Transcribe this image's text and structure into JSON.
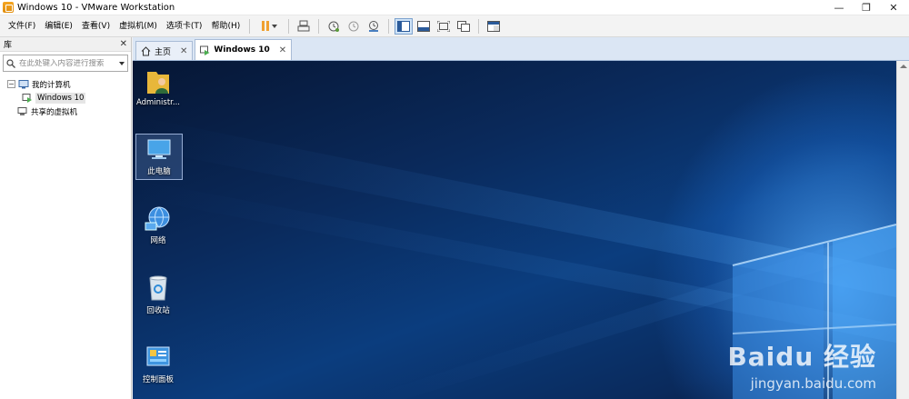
{
  "window": {
    "title": "Windows 10 - VMware Workstation",
    "minimize_glyph": "—",
    "restore_glyph": "❐",
    "close_glyph": "✕"
  },
  "menubar": {
    "items": [
      "文件(F)",
      "编辑(E)",
      "查看(V)",
      "虚拟机(M)",
      "选项卡(T)",
      "帮助(H)"
    ]
  },
  "toolbar": {
    "icons": [
      "pause-icon",
      "send-ctrl-alt-del-icon",
      "snapshot-icon",
      "revert-snapshot-icon",
      "snapshot-manager-icon",
      "show-library-icon",
      "thumbnail-bar-icon",
      "full-screen-icon",
      "unity-icon",
      "console-view-icon"
    ]
  },
  "library": {
    "title": "库",
    "close": "✕",
    "search_placeholder": "在此处键入内容进行搜索",
    "tree": {
      "my_computer": "我的计算机",
      "vm_windows10": "Windows 10",
      "shared_vms": "共享的虚拟机",
      "toggle": "−"
    }
  },
  "tabs": [
    {
      "label": "主页",
      "close": "✕"
    },
    {
      "label": "Windows 10",
      "close": "✕"
    }
  ],
  "desktop": {
    "icons": [
      {
        "label": "Administr..."
      },
      {
        "label": "此电脑"
      },
      {
        "label": "网络"
      },
      {
        "label": "回收站"
      },
      {
        "label": "控制面板"
      }
    ]
  },
  "watermark": {
    "logo": "Baidu 经验",
    "url": "jingyan.baidu.com"
  },
  "colors": {
    "accent": "#f0a030",
    "tab_strip": "#dbe6f4",
    "desktop_dark": "#061634",
    "desktop_light": "#50aaff"
  }
}
